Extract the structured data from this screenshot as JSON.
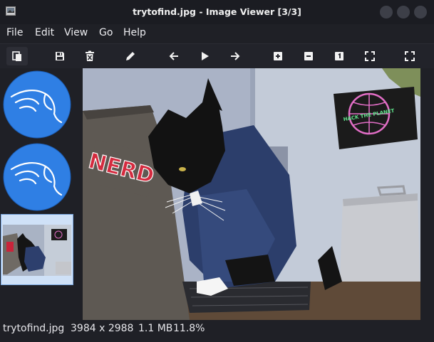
{
  "window": {
    "title": "trytofind.jpg - Image Viewer [3/3]",
    "accent": "#3d3f48"
  },
  "menu": [
    "File",
    "Edit",
    "Go",
    "Help"
  ],
  "menu_view": "View",
  "toolbar": {
    "icons": [
      "open-icon",
      "save-icon",
      "delete-icon",
      "edit-icon",
      "previous-icon",
      "play-icon",
      "next-icon",
      "zoom-in-icon",
      "zoom-out-icon",
      "actual-size-icon",
      "fit-window-icon",
      "fullscreen-icon"
    ]
  },
  "thumbnails": [
    {
      "name": "kali-logo-1"
    },
    {
      "name": "kali-logo-2"
    },
    {
      "name": "trytofind"
    }
  ],
  "image": {
    "sticker_text": "NERD",
    "poster_text": "HACK THE PLANET"
  },
  "status": {
    "filename": "trytofind.jpg",
    "dimensions": "3984 x 2988",
    "filesize": "1.1 MB",
    "zoom": "11.8%"
  },
  "colors": {
    "kali_blue": "#2f7fe4",
    "selection": "#cfe1f7"
  }
}
